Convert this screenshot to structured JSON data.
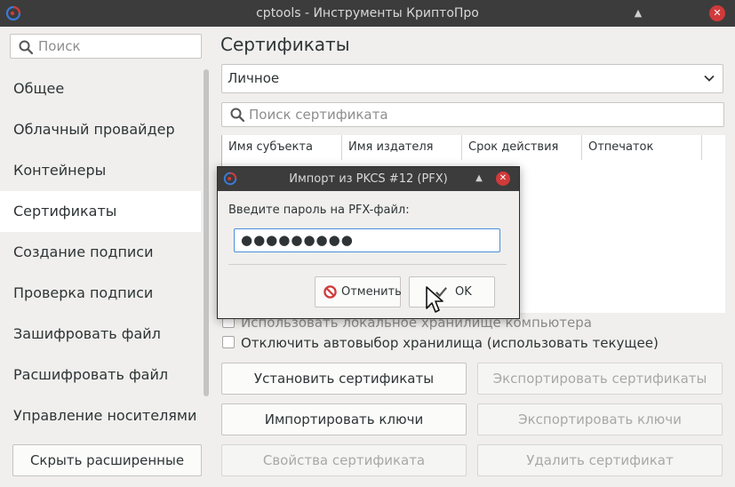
{
  "window": {
    "title": "cptools - Инструменты КриптоПро"
  },
  "sidebar": {
    "search_placeholder": "Поиск",
    "items": [
      {
        "label": "Общее"
      },
      {
        "label": "Облачный провайдер"
      },
      {
        "label": "Контейнеры"
      },
      {
        "label": "Сертификаты"
      },
      {
        "label": "Создание подписи"
      },
      {
        "label": "Проверка подписи"
      },
      {
        "label": "Зашифровать файл"
      },
      {
        "label": "Расшифровать файл"
      },
      {
        "label": "Управление носителями"
      }
    ],
    "active_index": 3,
    "collapse_label": "Скрыть расширенные"
  },
  "main": {
    "title": "Сертификаты",
    "store_selected": "Личное",
    "search_placeholder": "Поиск сертификата",
    "columns": [
      "Имя субъекта",
      "Имя издателя",
      "Срок действия",
      "Отпечаток"
    ],
    "checkbox_local_store": "Использовать локальное хранилище компьютера",
    "checkbox_disable_autoselect": "Отключить автовыбор хранилища (использовать текущее)",
    "buttons": {
      "install_certs": "Установить сертификаты",
      "export_certs": "Экспортировать сертификаты",
      "import_keys": "Импортировать ключи",
      "export_keys": "Экспортировать ключи",
      "cert_properties": "Свойства сертификата",
      "delete_cert": "Удалить сертификат"
    }
  },
  "dialog": {
    "title": "Импорт из PKCS #12 (PFX)",
    "prompt": "Введите пароль на PFX-файл:",
    "password_masked": "●●●●●●●●●",
    "cancel_label": "Отменить",
    "ok_label": "OK"
  },
  "colors": {
    "titlebar": "#3c3c3c",
    "close_red": "#d03a3a",
    "focus_blue": "#4a90d9"
  }
}
